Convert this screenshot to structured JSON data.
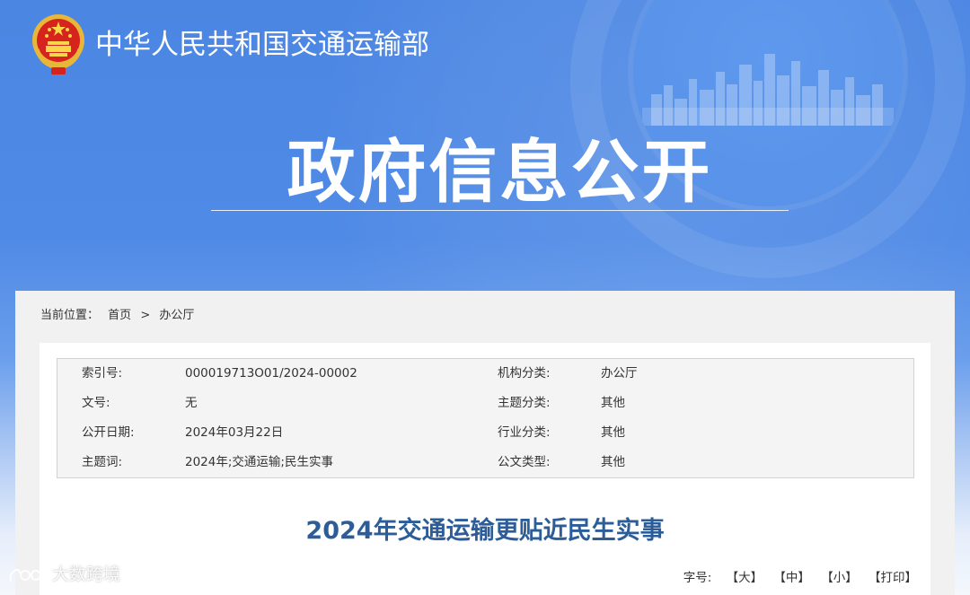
{
  "header": {
    "ministry_name": "中华人民共和国交通运输部",
    "page_heading": "政府信息公开"
  },
  "breadcrumb": {
    "label": "当前位置：",
    "home": "首页",
    "separator": ">",
    "current": "办公厅"
  },
  "meta": {
    "rows": [
      {
        "k1": "索引号:",
        "v1": "000019713O01/2024-00002",
        "k2": "机构分类:",
        "v2": "办公厅"
      },
      {
        "k1": "文号:",
        "v1": "无",
        "k2": "主题分类:",
        "v2": "其他"
      },
      {
        "k1": "公开日期:",
        "v1": "2024年03月22日",
        "k2": "行业分类:",
        "v2": "其他"
      },
      {
        "k1": "主题词:",
        "v1": "2024年;交通运输;民生实事",
        "k2": "公文类型:",
        "v2": "其他"
      }
    ]
  },
  "document": {
    "title": "2024年交通运输更贴近民生实事"
  },
  "font_tools": {
    "label": "字号:",
    "large": "【大】",
    "medium": "【中】",
    "small": "【小】",
    "print": "【打印】"
  },
  "watermark": {
    "text": "大数跨境"
  },
  "colors": {
    "header_blue": "#4b86e3",
    "title_blue": "#2c5d98",
    "panel_gray": "#f1f1f1"
  }
}
